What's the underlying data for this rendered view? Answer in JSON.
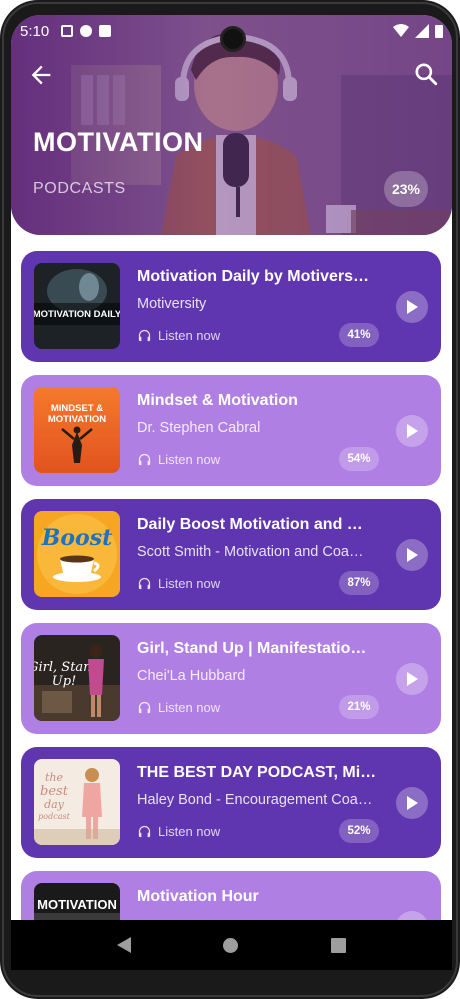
{
  "status_bar": {
    "time": "5:10"
  },
  "header": {
    "title": "MOTIVATION",
    "subtitle": "PODCASTS",
    "progress": "23%"
  },
  "podcasts": [
    {
      "title": "Motivation Daily by Motivers…",
      "author": "Motiversity",
      "listen_label": "Listen now",
      "progress": "41%",
      "thumb_text": "MOTIVATION DAILY",
      "style": "dark"
    },
    {
      "title": "Mindset & Motivation",
      "author": "Dr. Stephen Cabral",
      "listen_label": "Listen now",
      "progress": "54%",
      "thumb_text": "MINDSET & MOTIVATION",
      "style": "light"
    },
    {
      "title": "Daily Boost Motivation and …",
      "author": "Scott Smith - Motivation and Coa…",
      "listen_label": "Listen now",
      "progress": "87%",
      "thumb_text": "Boost",
      "style": "dark"
    },
    {
      "title": "Girl, Stand Up | Manifestatio…",
      "author": "Chei'La Hubbard",
      "listen_label": "Listen now",
      "progress": "21%",
      "thumb_text": "Girl, Stand Up!",
      "style": "light"
    },
    {
      "title": "THE BEST DAY PODCAST, Mi…",
      "author": "Haley Bond - Encouragement Coa…",
      "listen_label": "Listen now",
      "progress": "52%",
      "thumb_text": "the best day podcast",
      "style": "dark"
    },
    {
      "title": "Motivation Hour",
      "author": "",
      "listen_label": "",
      "progress": "",
      "thumb_text": "MOTIVATION",
      "style": "light"
    }
  ],
  "colors": {
    "card_dark": "#6035b0",
    "card_light": "#b07fe4",
    "header_tint": "#7a3d95"
  }
}
